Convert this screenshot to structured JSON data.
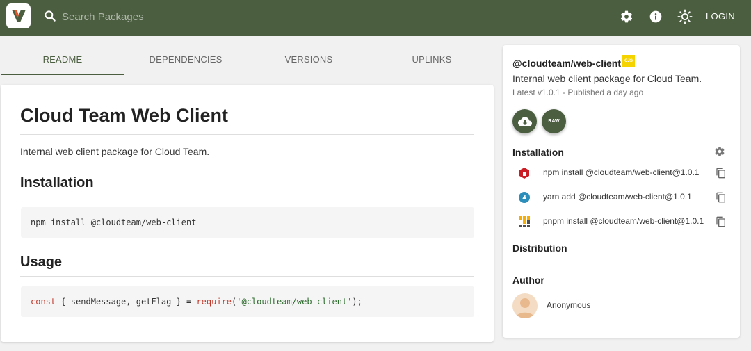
{
  "header": {
    "search_placeholder": "Search Packages",
    "login_label": "LOGIN",
    "brand_color": "#4b5e40",
    "icons": [
      "settings-icon",
      "info-icon",
      "theme-toggle-icon"
    ]
  },
  "tabs": [
    {
      "label": "README",
      "active": true
    },
    {
      "label": "DEPENDENCIES",
      "active": false
    },
    {
      "label": "VERSIONS",
      "active": false
    },
    {
      "label": "UPLINKS",
      "active": false
    }
  ],
  "readme": {
    "title": "Cloud Team Web Client",
    "description": "Internal web client package for Cloud Team.",
    "installation_heading": "Installation",
    "install_code": "npm install @cloudteam/web-client",
    "usage_heading": "Usage",
    "usage_code": {
      "keyword": "const",
      "destructure": " { sendMessage, getFlag } = ",
      "func": "require",
      "open": "(",
      "arg": "'@cloudteam/web-client'",
      "close": ");"
    }
  },
  "sidebar": {
    "package_name": "@cloudteam/web-client",
    "module_badge": "CJS",
    "description": "Internal web client package for Cloud Team.",
    "meta": "Latest v1.0.1 - Published a day ago",
    "raw_label": "RAW",
    "installation_title": "Installation",
    "install_commands": [
      {
        "manager": "npm",
        "icon": "npm-icon",
        "command": "npm install @cloudteam/web-client@1.0.1"
      },
      {
        "manager": "yarn",
        "icon": "yarn-icon",
        "command": "yarn add @cloudteam/web-client@1.0.1"
      },
      {
        "manager": "pnpm",
        "icon": "pnpm-icon",
        "command": "pnpm install @cloudteam/web-client@1.0.1"
      }
    ],
    "distribution_title": "Distribution",
    "author_title": "Author",
    "author_name": "Anonymous"
  }
}
